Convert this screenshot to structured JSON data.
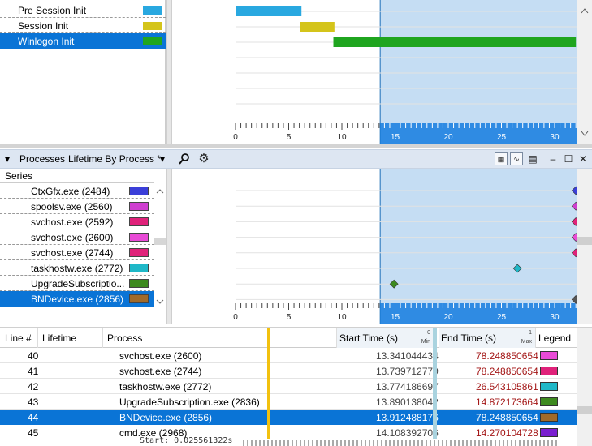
{
  "top_pane": {
    "phases": [
      {
        "label": "Pre Session Init",
        "color": "#29a8e0",
        "selected": false
      },
      {
        "label": "Session Init",
        "color": "#d4c41a",
        "selected": false
      },
      {
        "label": "Winlogon Init",
        "color": "#1fa51f",
        "selected": true
      }
    ],
    "axis_ticks": [
      "0",
      "5",
      "10",
      "15",
      "20",
      "25",
      "30"
    ]
  },
  "toolbar": {
    "title": "Processes",
    "view": "Lifetime By Process *",
    "dropdown_glyph": "▾",
    "search_glyph": "⚲",
    "settings_glyph": "⚙",
    "buttons": {
      "min": "–",
      "max": "☐",
      "close": "✕"
    }
  },
  "series_panel": {
    "header": "Series",
    "items": [
      {
        "label": "CtxGfx.exe (2484)",
        "color": "#3b3fd9",
        "selected": false
      },
      {
        "label": "spoolsv.exe (2560)",
        "color": "#cf3fd0",
        "selected": false
      },
      {
        "label": "svchost.exe (2592)",
        "color": "#e0227a",
        "selected": false
      },
      {
        "label": "svchost.exe (2600)",
        "color": "#e84ad6",
        "selected": false
      },
      {
        "label": "svchost.exe (2744)",
        "color": "#e0227a",
        "selected": false
      },
      {
        "label": "taskhostw.exe (2772)",
        "color": "#1fb8c8",
        "selected": false
      },
      {
        "label": "UpgradeSubscriptio...",
        "color": "#3d8a1f",
        "selected": false
      },
      {
        "label": "BNDevice.exe (2856)",
        "color": "#a06a2a",
        "selected": true
      }
    ],
    "axis_ticks": [
      "0",
      "5",
      "10",
      "15",
      "20",
      "25",
      "30"
    ]
  },
  "table": {
    "headers": {
      "line": "Line #",
      "lifetime": "Lifetime",
      "process": "Process",
      "start": "Start Time (s)",
      "start_min": "Min",
      "start_num": "0",
      "end": "End Time (s)",
      "end_max": "Max",
      "end_num": "1",
      "legend": "Legend"
    },
    "rows": [
      {
        "line": "40",
        "process": "svchost.exe (2600)",
        "start": "13.341044434",
        "end": "78.248850654",
        "color": "#e84ad6",
        "selected": false
      },
      {
        "line": "41",
        "process": "svchost.exe (2744)",
        "start": "13.739712779",
        "end": "78.248850654",
        "color": "#e0227a",
        "selected": false
      },
      {
        "line": "42",
        "process": "taskhostw.exe (2772)",
        "start": "13.774186697",
        "end": "26.543105861",
        "color": "#1fb8c8",
        "selected": false
      },
      {
        "line": "43",
        "process": "UpgradeSubscription.exe (2836)",
        "start": "13.890138042",
        "end": "14.872173664",
        "color": "#3d8a1f",
        "selected": false
      },
      {
        "line": "44",
        "process": "BNDevice.exe (2856)",
        "start": "13.912488176",
        "end": "78.248850654",
        "color": "#a06a2a",
        "selected": true
      },
      {
        "line": "45",
        "process": "cmd.exe (2968)",
        "start": "14.108392706",
        "end": "14.270104728",
        "color": "#7a1fd0",
        "selected": false
      }
    ],
    "footer_start": "Start:  0.025561322s"
  },
  "colors": {
    "selection": "#0a74d6",
    "selected_region": "#c5ddf3",
    "axis_blue": "#1a7fe0"
  }
}
